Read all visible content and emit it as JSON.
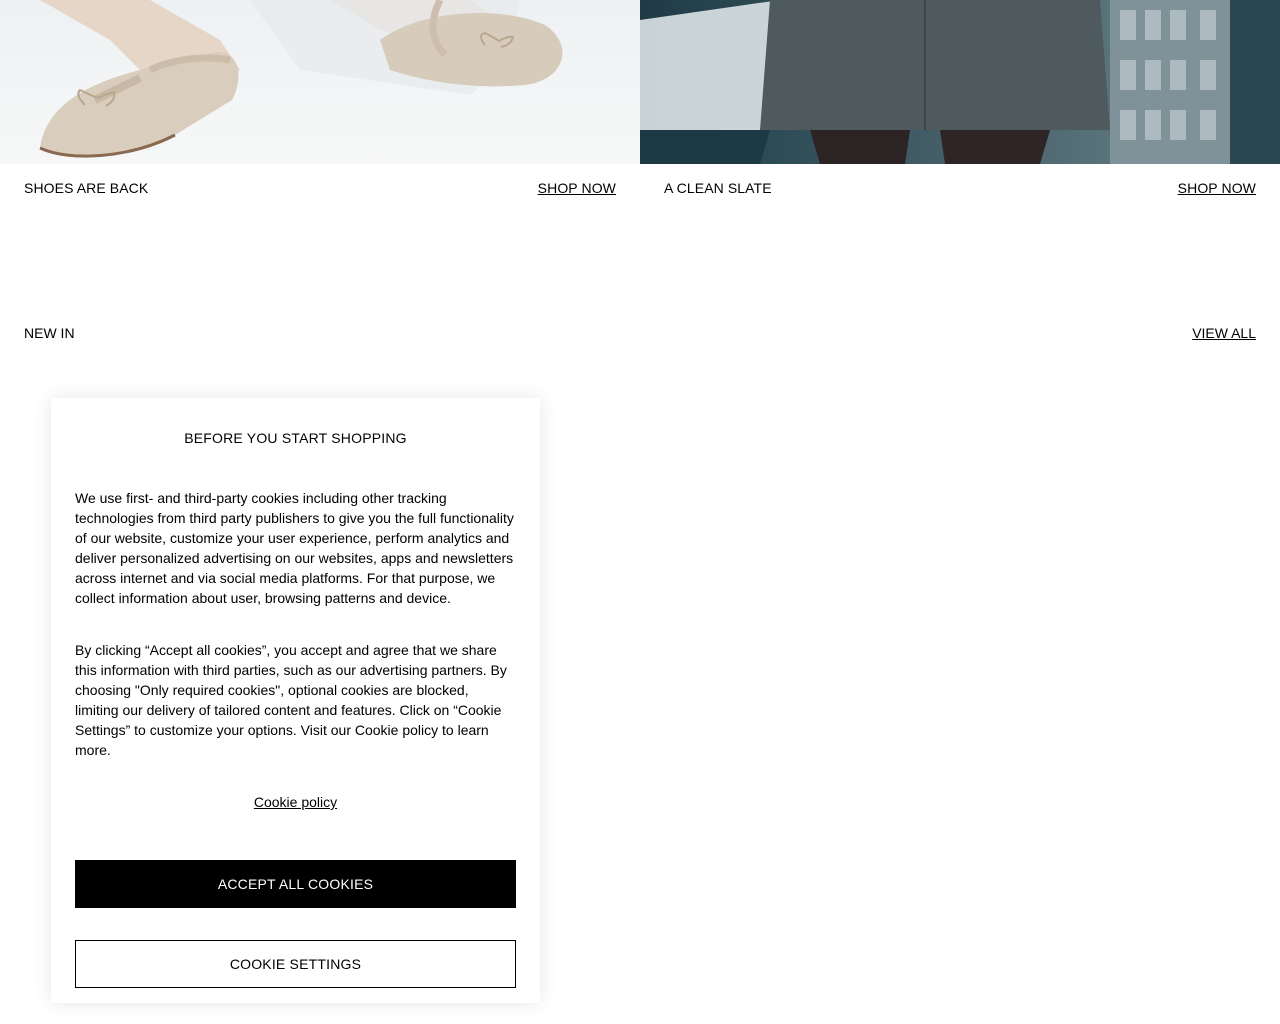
{
  "promos": [
    {
      "title": "SHOES ARE BACK",
      "cta": "SHOP NOW"
    },
    {
      "title": "A CLEAN SLATE",
      "cta": "SHOP NOW"
    }
  ],
  "new_in": {
    "title": "NEW IN",
    "cta": "VIEW ALL"
  },
  "cookie_modal": {
    "title": "BEFORE YOU START SHOPPING",
    "paragraph1": "We use first- and third-party cookies including other tracking technologies from third party publishers to give you the full functionality of our website, customize your user experience, perform analytics and deliver personalized advertising on our websites, apps and newsletters across internet and via social media platforms. For that purpose, we collect information about user, browsing patterns and device.",
    "paragraph2": "By clicking “Accept all cookies”, you accept and agree that we share this information with third parties, such as our advertising partners. By choosing \"Only required cookies\", optional cookies are blocked, limiting our delivery of tailored content and features. Click on “Cookie Settings” to customize your options. Visit our Cookie policy to learn more.",
    "policy_link": "Cookie policy",
    "accept_button": "ACCEPT ALL COOKIES",
    "settings_button": "COOKIE SETTINGS"
  },
  "colors": {
    "primary": "#000000",
    "background": "#ffffff"
  }
}
